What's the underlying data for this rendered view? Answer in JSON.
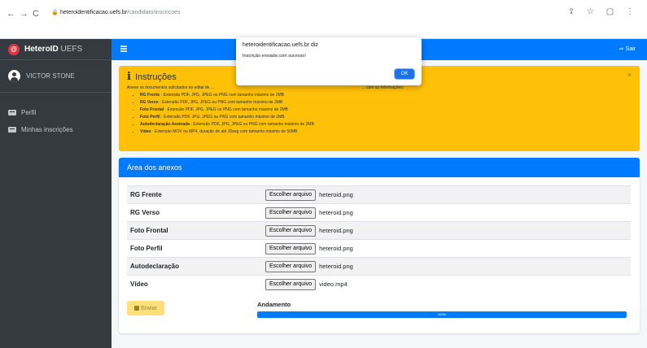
{
  "browser": {
    "back": "←",
    "forward": "→",
    "reload": "C",
    "url_host": "heteroidentificacao.uefs.br",
    "url_path": "/candidato/inscricoes",
    "icons": "⇪ ☆ ▢ ⋮"
  },
  "sidebar": {
    "brand_logo": "@",
    "brand_bold": "HeteroID",
    "brand_rest": " UEFS",
    "user_name": "VICTOR STONE",
    "items": [
      {
        "label": "Perfil"
      },
      {
        "label": "Minhas inscrições"
      }
    ]
  },
  "topnav": {
    "logout_label": "⇨ Sair"
  },
  "instructions": {
    "title": "Instruções",
    "intro": "Anexe os documentos solicitados no edital de ...",
    "intro_tail": "... com as informações:",
    "items": [
      {
        "name": "RG Frente",
        "desc": " - Extensão PDF, JPG, JPEG ou PNG com tamanho máximo de 2MB"
      },
      {
        "name": "RG Verso",
        "desc": " - Extensão PDF, JPG, JPEG ou PNG com tamanho máximo de 2MB"
      },
      {
        "name": "Foto Frontal",
        "desc": " - Extensão PDF, JPG, JPEG ou PNG com tamanho máximo de 2MB"
      },
      {
        "name": "Foto Perfil",
        "desc": " - Extensão PDF, JPG, JPEG ou PNG com tamanho máximo de 2MB"
      },
      {
        "name": "Autodeclaração Assinada",
        "desc": " - Extensão PDF, JPG, JPEG ou PNG com tamanho máximo de 2MB"
      },
      {
        "name": "Vídeo",
        "desc": " - Extensão MOV ou MP4, duração de até 20seg com tamanho máximo de 50MB"
      }
    ],
    "close": "×"
  },
  "anexos": {
    "title": "Área dos anexos",
    "button_label": "Escolher arquivo",
    "rows": [
      {
        "label": "RG Frente",
        "file": "heteroid.png"
      },
      {
        "label": "RG Verso",
        "file": "heteroid.png"
      },
      {
        "label": "Foto Frontal",
        "file": "heteroid.png"
      },
      {
        "label": "Foto Perfil",
        "file": "heteroid.png"
      },
      {
        "label": "Autodeclaração",
        "file": "heteroid.png"
      },
      {
        "label": "Vídeo",
        "file": "video.mp4"
      }
    ],
    "send_label": "Enviar",
    "progress_label": "Andamento",
    "progress_value": 100,
    "progress_text": "100%"
  },
  "dialog": {
    "title": "heteroidentificacao.uefs.br diz",
    "message": "Inscrição enviada com sucesso!",
    "ok_label": "OK"
  }
}
